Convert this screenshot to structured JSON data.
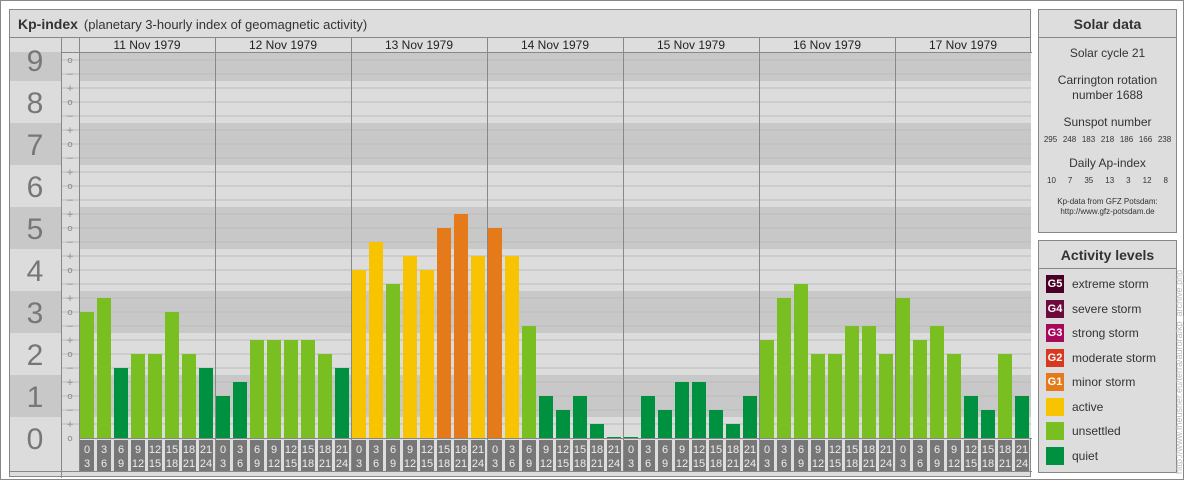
{
  "title": {
    "main": "Kp-index",
    "sub": "(planetary 3-hourly index of geomagnetic activity)"
  },
  "chart_data": {
    "type": "bar",
    "title": "Kp-index",
    "ylim": [
      0,
      9
    ],
    "yticks": [
      "0",
      "1",
      "2",
      "3",
      "4",
      "5",
      "6",
      "7",
      "8",
      "9"
    ],
    "minor_ticks": [
      "−",
      "o",
      "+"
    ],
    "days": [
      "11 Nov 1979",
      "12 Nov 1979",
      "13 Nov 1979",
      "14 Nov 1979",
      "15 Nov 1979",
      "16 Nov 1979",
      "17 Nov 1979"
    ],
    "intervals": [
      [
        "0",
        "3"
      ],
      [
        "3",
        "6"
      ],
      [
        "6",
        "9"
      ],
      [
        "9",
        "12"
      ],
      [
        "12",
        "15"
      ],
      [
        "15",
        "18"
      ],
      [
        "18",
        "21"
      ],
      [
        "21",
        "24"
      ]
    ],
    "kp": [
      [
        "3o",
        "3+",
        "2-",
        "2o",
        "2o",
        "3o",
        "2o",
        "2-"
      ],
      [
        "1o",
        "1+",
        "2+",
        "2+",
        "2+",
        "2+",
        "2o",
        "2-"
      ],
      [
        "4o",
        "5-",
        "4-",
        "4+",
        "4o",
        "5o",
        "5+",
        "4+"
      ],
      [
        "5o",
        "4+",
        "3-",
        "1o",
        "1-",
        "1o",
        "0+",
        "0o"
      ],
      [
        "0o",
        "1o",
        "1-",
        "1+",
        "1+",
        "1-",
        "0+",
        "1o"
      ],
      [
        "2+",
        "3+",
        "4-",
        "2o",
        "2o",
        "3-",
        "3-",
        "2o"
      ],
      [
        "3+",
        "2+",
        "3-",
        "2o",
        "1o",
        "1-",
        "2o",
        "1o"
      ]
    ]
  },
  "solar": {
    "title": "Solar data",
    "cycle": "Solar cycle 21",
    "carrington1": "Carrington rotation",
    "carrington2": "number 1688",
    "sunspot_label": "Sunspot number",
    "sunspots": [
      "295",
      "248",
      "183",
      "218",
      "186",
      "166",
      "238"
    ],
    "ap_label": "Daily Ap-index",
    "ap": [
      "10",
      "7",
      "35",
      "13",
      "3",
      "12",
      "8"
    ],
    "source1": "Kp-data from GFZ Potsdam:",
    "source2": "http://www.gfz-potsdam.de"
  },
  "levels": {
    "title": "Activity levels",
    "items": [
      {
        "badge": "G5",
        "label": "extreme storm",
        "color": "#4a0026"
      },
      {
        "badge": "G4",
        "label": "severe storm",
        "color": "#6e0a3e"
      },
      {
        "badge": "G3",
        "label": "strong storm",
        "color": "#a8085c"
      },
      {
        "badge": "G2",
        "label": "moderate storm",
        "color": "#d9381f"
      },
      {
        "badge": "G1",
        "label": "minor storm",
        "color": "#e57a1a"
      },
      {
        "badge": "",
        "label": "active",
        "color": "#f8c300"
      },
      {
        "badge": "",
        "label": "unsettled",
        "color": "#79bf21"
      },
      {
        "badge": "",
        "label": "quiet",
        "color": "#009140"
      }
    ]
  },
  "watermark": "http://www.fheusner.eu/terra/aurora/kp_archive.php"
}
